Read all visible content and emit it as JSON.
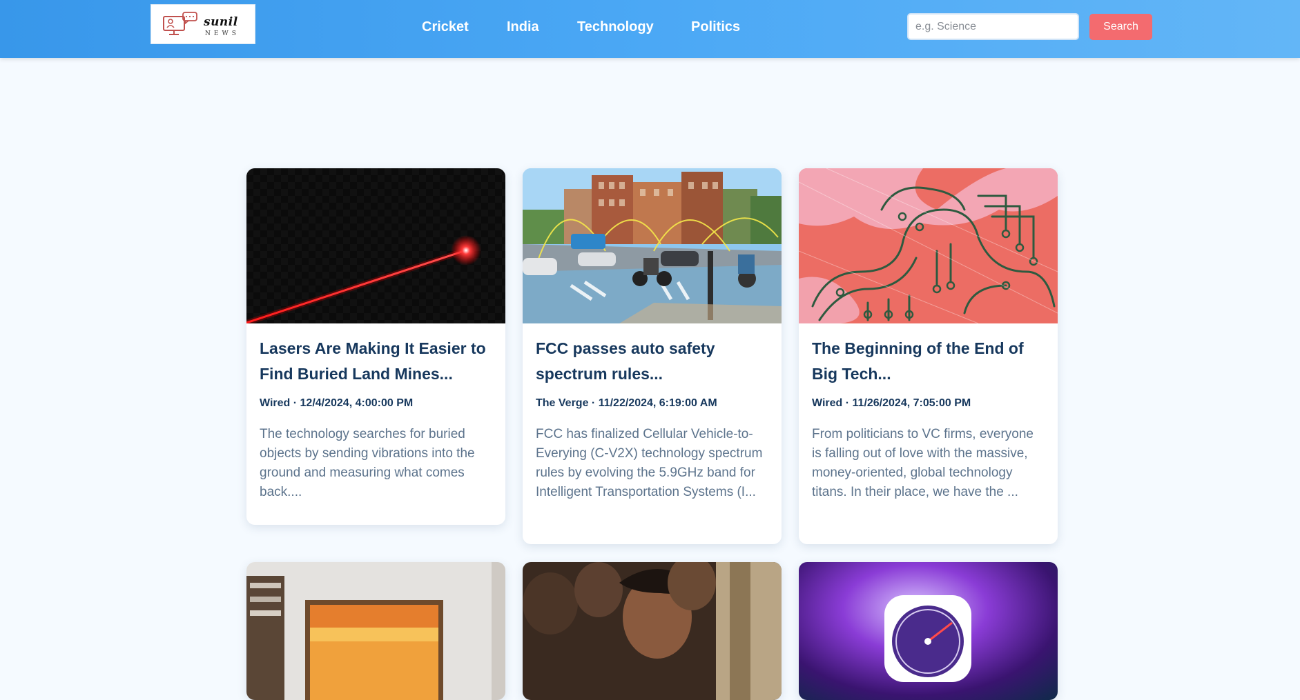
{
  "header": {
    "logo_text": "sunil",
    "logo_subtext": "NEWS",
    "nav": [
      "Cricket",
      "India",
      "Technology",
      "Politics"
    ],
    "search_placeholder": "e.g. Science",
    "search_button": "Search"
  },
  "articles": [
    {
      "title": "Lasers Are Making It Easier to Find Buried Land Mines...",
      "meta": "Wired · 12/4/2024, 4:00:00 PM",
      "description": "The technology searches for buried objects by sending vibrations into the ground and measuring what comes back....",
      "image_icon": "laser-beam-image"
    },
    {
      "title": "FCC passes auto safety spectrum rules...",
      "meta": "The Verge · 11/22/2024, 6:19:00 AM",
      "description": "FCC has finalized Cellular Vehicle-to-Everying (C-V2X) technology spectrum rules by evolving the 5.9GHz band for Intelligent Transportation Systems (I...",
      "image_icon": "street-intersection-image"
    },
    {
      "title": "The Beginning of the End of Big Tech...",
      "meta": "Wired · 11/26/2024, 7:05:00 PM",
      "description": "From politicians to VC firms, everyone is falling out of love with the massive, money-oriented, global technology titans. In their place, we have the ...",
      "image_icon": "circuit-illustration-image"
    },
    {
      "image_icon": "framed-tv-image"
    },
    {
      "image_icon": "crowd-photo-image"
    },
    {
      "image_icon": "speedometer-app-image"
    }
  ],
  "colors": {
    "header_gradient": [
      "#3897ea",
      "#63b6f7"
    ],
    "search_button": "#f36b6f",
    "title_text": "#17385d",
    "description_text": "#5c738c",
    "page_background": "#f5faff"
  }
}
